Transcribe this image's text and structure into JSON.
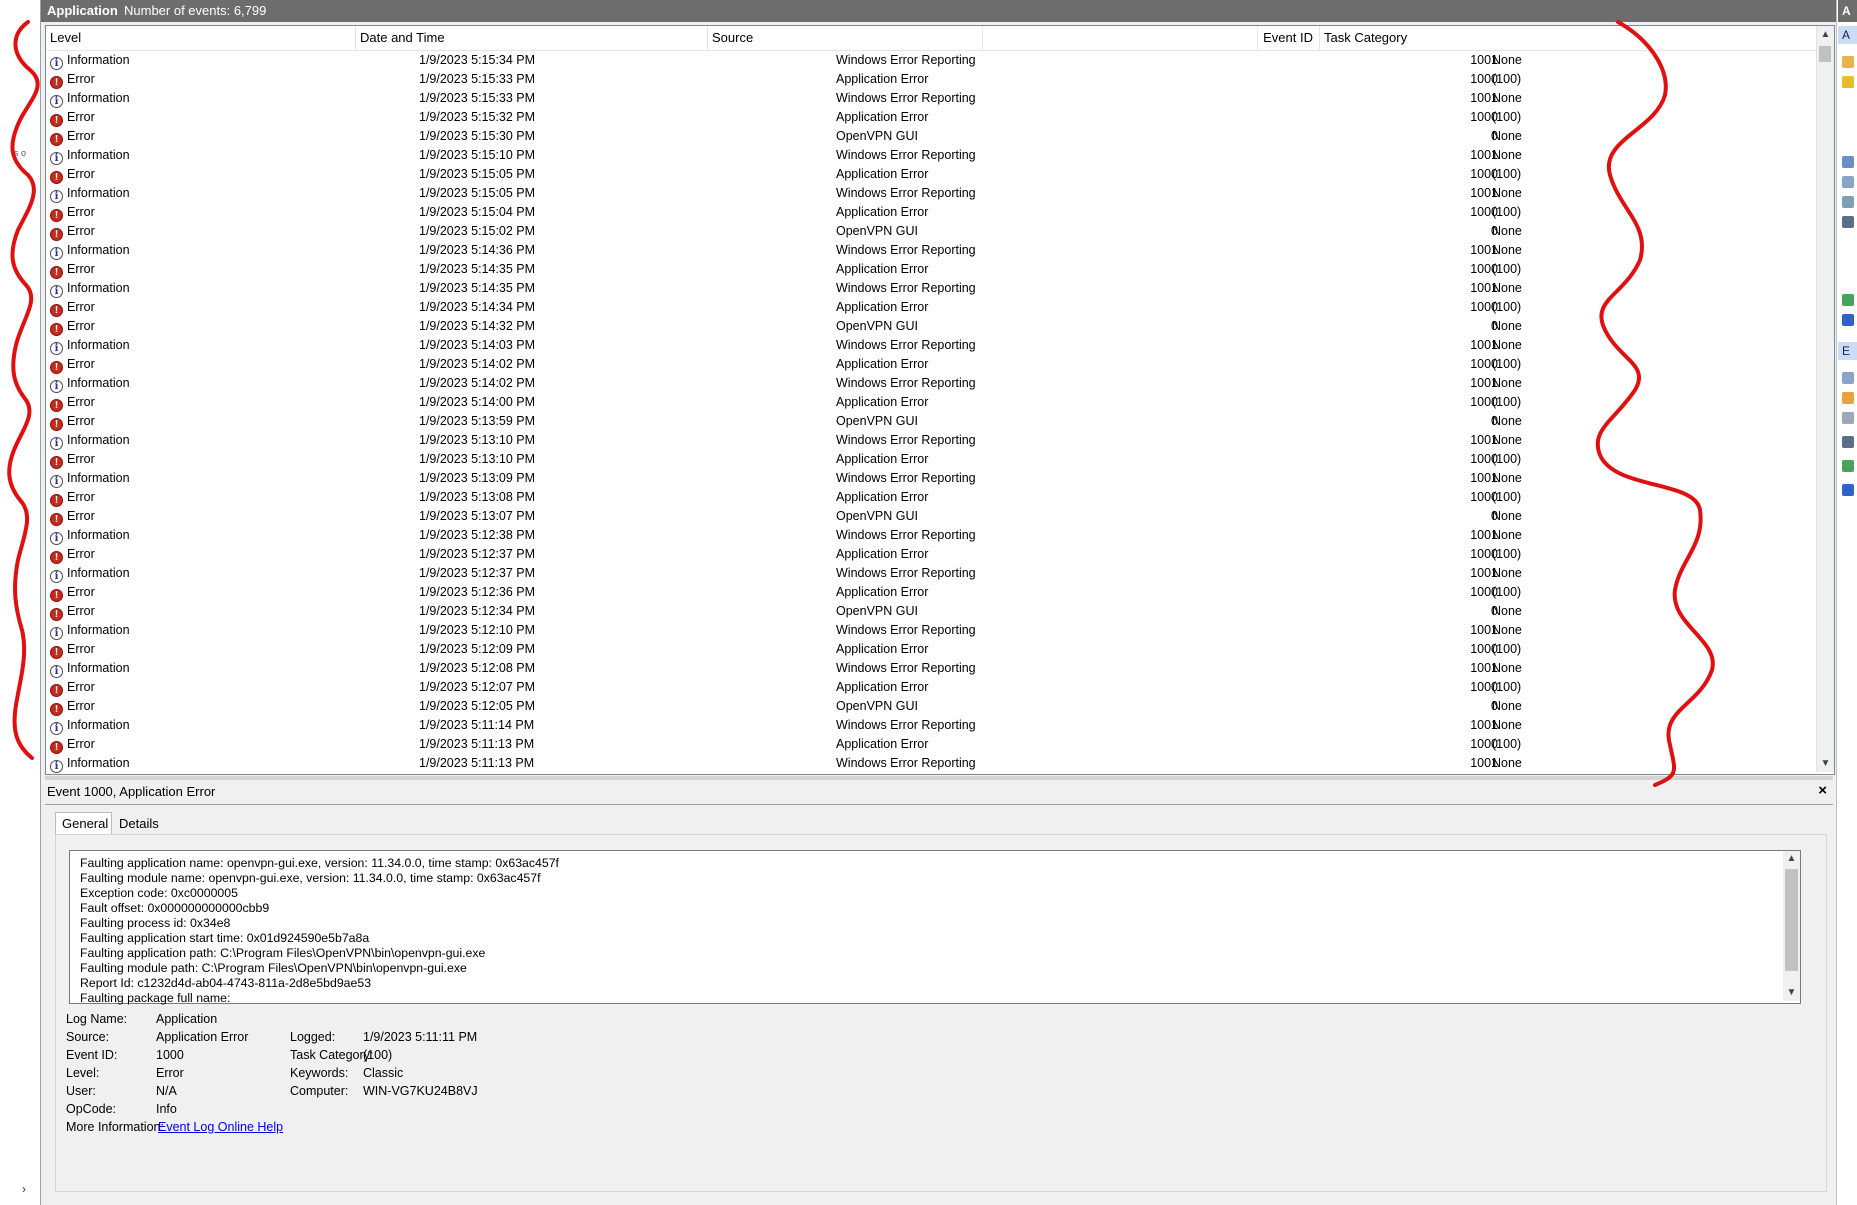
{
  "window": {
    "title": "Application",
    "event_count": "Number of events: 6,799"
  },
  "columns": {
    "level": "Level",
    "date": "Date and Time",
    "source": "Source",
    "event_id": "Event ID",
    "task": "Task Category"
  },
  "events": [
    {
      "level": "Information",
      "date": "1/9/2023 5:15:34 PM",
      "source": "Windows Error Reporting",
      "id": "1001",
      "task": "None"
    },
    {
      "level": "Error",
      "date": "1/9/2023 5:15:33 PM",
      "source": "Application Error",
      "id": "1000",
      "task": "(100)"
    },
    {
      "level": "Information",
      "date": "1/9/2023 5:15:33 PM",
      "source": "Windows Error Reporting",
      "id": "1001",
      "task": "None"
    },
    {
      "level": "Error",
      "date": "1/9/2023 5:15:32 PM",
      "source": "Application Error",
      "id": "1000",
      "task": "(100)"
    },
    {
      "level": "Error",
      "date": "1/9/2023 5:15:30 PM",
      "source": "OpenVPN GUI",
      "id": "0",
      "task": "None"
    },
    {
      "level": "Information",
      "date": "1/9/2023 5:15:10 PM",
      "source": "Windows Error Reporting",
      "id": "1001",
      "task": "None"
    },
    {
      "level": "Error",
      "date": "1/9/2023 5:15:05 PM",
      "source": "Application Error",
      "id": "1000",
      "task": "(100)"
    },
    {
      "level": "Information",
      "date": "1/9/2023 5:15:05 PM",
      "source": "Windows Error Reporting",
      "id": "1001",
      "task": "None"
    },
    {
      "level": "Error",
      "date": "1/9/2023 5:15:04 PM",
      "source": "Application Error",
      "id": "1000",
      "task": "(100)"
    },
    {
      "level": "Error",
      "date": "1/9/2023 5:15:02 PM",
      "source": "OpenVPN GUI",
      "id": "0",
      "task": "None"
    },
    {
      "level": "Information",
      "date": "1/9/2023 5:14:36 PM",
      "source": "Windows Error Reporting",
      "id": "1001",
      "task": "None"
    },
    {
      "level": "Error",
      "date": "1/9/2023 5:14:35 PM",
      "source": "Application Error",
      "id": "1000",
      "task": "(100)"
    },
    {
      "level": "Information",
      "date": "1/9/2023 5:14:35 PM",
      "source": "Windows Error Reporting",
      "id": "1001",
      "task": "None"
    },
    {
      "level": "Error",
      "date": "1/9/2023 5:14:34 PM",
      "source": "Application Error",
      "id": "1000",
      "task": "(100)"
    },
    {
      "level": "Error",
      "date": "1/9/2023 5:14:32 PM",
      "source": "OpenVPN GUI",
      "id": "0",
      "task": "None"
    },
    {
      "level": "Information",
      "date": "1/9/2023 5:14:03 PM",
      "source": "Windows Error Reporting",
      "id": "1001",
      "task": "None"
    },
    {
      "level": "Error",
      "date": "1/9/2023 5:14:02 PM",
      "source": "Application Error",
      "id": "1000",
      "task": "(100)"
    },
    {
      "level": "Information",
      "date": "1/9/2023 5:14:02 PM",
      "source": "Windows Error Reporting",
      "id": "1001",
      "task": "None"
    },
    {
      "level": "Error",
      "date": "1/9/2023 5:14:00 PM",
      "source": "Application Error",
      "id": "1000",
      "task": "(100)"
    },
    {
      "level": "Error",
      "date": "1/9/2023 5:13:59 PM",
      "source": "OpenVPN GUI",
      "id": "0",
      "task": "None"
    },
    {
      "level": "Information",
      "date": "1/9/2023 5:13:10 PM",
      "source": "Windows Error Reporting",
      "id": "1001",
      "task": "None"
    },
    {
      "level": "Error",
      "date": "1/9/2023 5:13:10 PM",
      "source": "Application Error",
      "id": "1000",
      "task": "(100)"
    },
    {
      "level": "Information",
      "date": "1/9/2023 5:13:09 PM",
      "source": "Windows Error Reporting",
      "id": "1001",
      "task": "None"
    },
    {
      "level": "Error",
      "date": "1/9/2023 5:13:08 PM",
      "source": "Application Error",
      "id": "1000",
      "task": "(100)"
    },
    {
      "level": "Error",
      "date": "1/9/2023 5:13:07 PM",
      "source": "OpenVPN GUI",
      "id": "0",
      "task": "None"
    },
    {
      "level": "Information",
      "date": "1/9/2023 5:12:38 PM",
      "source": "Windows Error Reporting",
      "id": "1001",
      "task": "None"
    },
    {
      "level": "Error",
      "date": "1/9/2023 5:12:37 PM",
      "source": "Application Error",
      "id": "1000",
      "task": "(100)"
    },
    {
      "level": "Information",
      "date": "1/9/2023 5:12:37 PM",
      "source": "Windows Error Reporting",
      "id": "1001",
      "task": "None"
    },
    {
      "level": "Error",
      "date": "1/9/2023 5:12:36 PM",
      "source": "Application Error",
      "id": "1000",
      "task": "(100)"
    },
    {
      "level": "Error",
      "date": "1/9/2023 5:12:34 PM",
      "source": "OpenVPN GUI",
      "id": "0",
      "task": "None"
    },
    {
      "level": "Information",
      "date": "1/9/2023 5:12:10 PM",
      "source": "Windows Error Reporting",
      "id": "1001",
      "task": "None"
    },
    {
      "level": "Error",
      "date": "1/9/2023 5:12:09 PM",
      "source": "Application Error",
      "id": "1000",
      "task": "(100)"
    },
    {
      "level": "Information",
      "date": "1/9/2023 5:12:08 PM",
      "source": "Windows Error Reporting",
      "id": "1001",
      "task": "None"
    },
    {
      "level": "Error",
      "date": "1/9/2023 5:12:07 PM",
      "source": "Application Error",
      "id": "1000",
      "task": "(100)"
    },
    {
      "level": "Error",
      "date": "1/9/2023 5:12:05 PM",
      "source": "OpenVPN GUI",
      "id": "0",
      "task": "None"
    },
    {
      "level": "Information",
      "date": "1/9/2023 5:11:14 PM",
      "source": "Windows Error Reporting",
      "id": "1001",
      "task": "None"
    },
    {
      "level": "Error",
      "date": "1/9/2023 5:11:13 PM",
      "source": "Application Error",
      "id": "1000",
      "task": "(100)"
    },
    {
      "level": "Information",
      "date": "1/9/2023 5:11:13 PM",
      "source": "Windows Error Reporting",
      "id": "1001",
      "task": "None"
    }
  ],
  "detail": {
    "title": "Event 1000, Application Error",
    "close_glyph": "×",
    "tabs": [
      "General",
      "Details"
    ],
    "description_lines": [
      "Faulting application name: openvpn-gui.exe, version: 11.34.0.0, time stamp: 0x63ac457f",
      "Faulting module name: openvpn-gui.exe, version: 11.34.0.0, time stamp: 0x63ac457f",
      "Exception code: 0xc0000005",
      "Fault offset: 0x000000000000cbb9",
      "Faulting process id: 0x34e8",
      "Faulting application start time: 0x01d924590e5b7a8a",
      "Faulting application path: C:\\Program Files\\OpenVPN\\bin\\openvpn-gui.exe",
      "Faulting module path: C:\\Program Files\\OpenVPN\\bin\\openvpn-gui.exe",
      "Report Id: c1232d4d-ab04-4743-811a-2d8e5bd9ae53",
      "Faulting package full name:"
    ],
    "properties": {
      "log_name_label": "Log Name:",
      "log_name": "Application",
      "source_label": "Source:",
      "source": "Application Error",
      "logged_label": "Logged:",
      "logged": "1/9/2023 5:11:11 PM",
      "event_id_label": "Event ID:",
      "event_id": "1000",
      "task_label": "Task Category:",
      "task": "(100)",
      "level_label": "Level:",
      "level": "Error",
      "keywords_label": "Keywords:",
      "keywords": "Classic",
      "user_label": "User:",
      "user": "N/A",
      "computer_label": "Computer:",
      "computer": "WIN-VG7KU24B8VJ",
      "opcode_label": "OpCode:",
      "opcode": "Info",
      "more_info_label": "More Information:",
      "more_info_link": "Event Log Online Help"
    }
  },
  "right_strip": {
    "top_letter": "A",
    "hl1": "A",
    "hl2": "E"
  },
  "left_strip": {
    "expand_glyph": "›",
    "stray_text": "s o"
  },
  "colors": {
    "title_bar": "#6d6d6d",
    "error_icon": "#c42b1c",
    "annotation": "#e01010",
    "link": "#0000ee"
  }
}
